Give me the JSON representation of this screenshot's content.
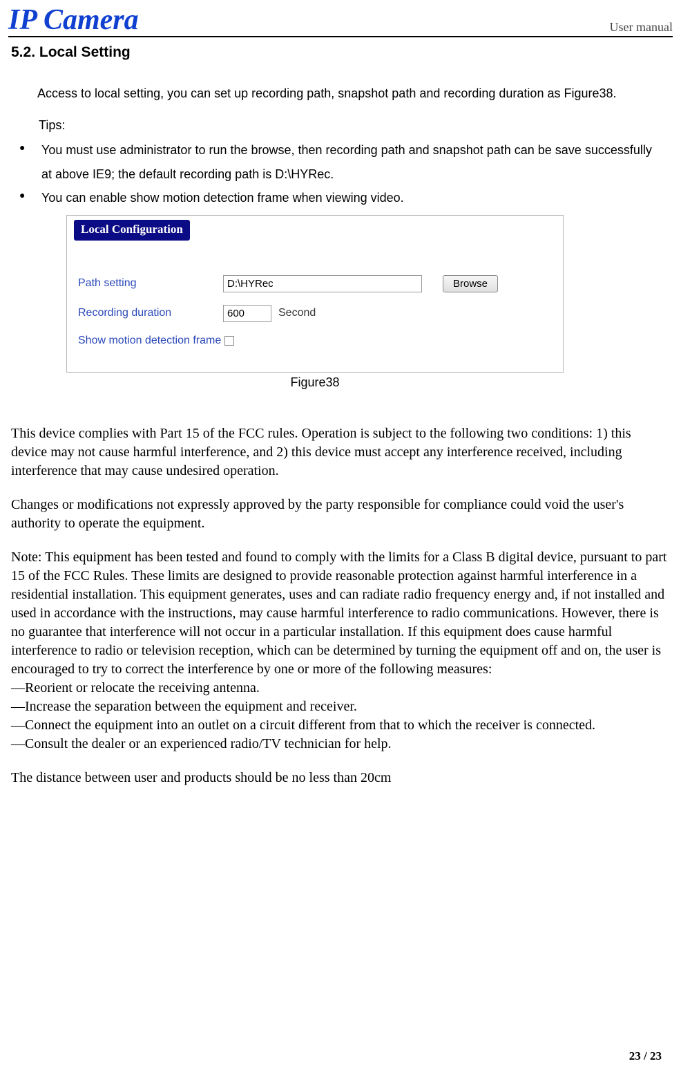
{
  "header": {
    "logo": "IP Camera",
    "right": "User manual"
  },
  "section": {
    "number": "5.2.",
    "title": "Local Setting"
  },
  "intro": "Access to local setting, you can set up recording path, snapshot path and recording duration as Figure38.",
  "tips_label": "Tips:",
  "tips": [
    "You must use administrator to run the browse, then recording path and snapshot path can be save successfully at above IE9; the default recording path is D:\\HYRec.",
    "You can enable show motion detection frame when viewing video."
  ],
  "config": {
    "title": "Local Configuration",
    "path_label": "Path setting",
    "path_value": "D:\\HYRec",
    "browse": "Browse",
    "duration_label": "Recording duration",
    "duration_value": "600",
    "second": "Second",
    "motion_label": "Show motion detection frame"
  },
  "figure_caption": "Figure38",
  "fcc": {
    "p1": "This device complies with Part 15 of the FCC rules. Operation is subject to the following two conditions: 1) this device may not cause harmful interference, and 2) this device must accept any interference received, including interference that may cause undesired operation.",
    "p2": "Changes or modifications not expressly approved by the party responsible for compliance could void the user's authority to operate the equipment.",
    "p3": "Note: This equipment has been tested and found to comply with the limits for a Class B digital device, pursuant to part 15 of the FCC Rules. These limits are designed to provide reasonable protection against harmful interference in a residential installation. This equipment generates, uses and can radiate radio frequency energy and, if not installed and used in accordance with the instructions, may cause harmful interference to radio communications. However, there is no guarantee that interference will not occur in a particular installation. If this equipment does cause harmful interference to radio or television reception, which can be determined by turning the equipment off and on, the user is encouraged to try to correct the interference by one or more of the following measures:",
    "m1": "—Reorient or relocate the receiving antenna.",
    "m2": "—Increase the separation between the equipment and receiver.",
    "m3": "—Connect the equipment into an outlet on a circuit different from that to which the receiver is connected.",
    "m4": "—Consult the dealer or an experienced radio/TV technician for help.",
    "p4": "The distance between user and products should be no less than 20cm"
  },
  "page_num": "23 / 23"
}
